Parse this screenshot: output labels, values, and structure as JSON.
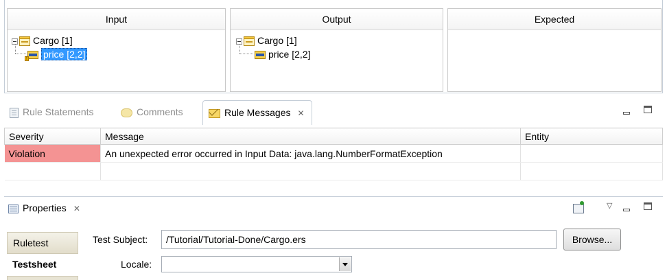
{
  "tree_panel": {
    "columns": [
      {
        "header": "Input",
        "root_label": "Cargo [1]",
        "child_label": "price [2,2]"
      },
      {
        "header": "Output",
        "root_label": "Cargo [1]",
        "child_label": "price [2,2]"
      },
      {
        "header": "Expected"
      }
    ]
  },
  "view_tabs": {
    "rule_statements": "Rule Statements",
    "comments": "Comments",
    "rule_messages": "Rule Messages"
  },
  "messages_table": {
    "headers": [
      "Severity",
      "Message",
      "Entity"
    ],
    "rows": [
      {
        "severity": "Violation",
        "message": "An unexpected error occurred in Input Data:  java.lang.NumberFormatException",
        "entity": ""
      }
    ]
  },
  "properties": {
    "tab_label": "Properties",
    "side_tabs": [
      "Ruletest",
      "Testsheet"
    ],
    "test_subject_label": "Test Subject:",
    "test_subject_value": "/Tutorial/Tutorial-Done/Cargo.ers",
    "browse_label": "Browse...",
    "locale_label": "Locale:",
    "locale_value": ""
  },
  "colors": {
    "violation": "#f49393",
    "selection": "#3399ff"
  }
}
